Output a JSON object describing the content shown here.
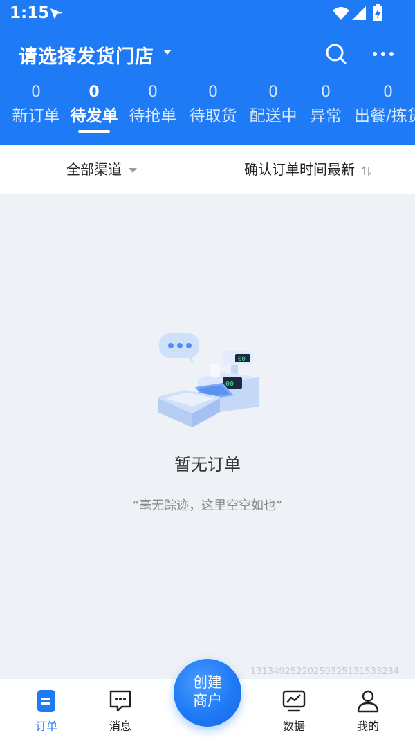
{
  "status_bar": {
    "time": "1:15"
  },
  "header": {
    "store_title": "请选择发货门店",
    "tabs": [
      {
        "count": "0",
        "label": "新订单"
      },
      {
        "count": "0",
        "label": "待发单"
      },
      {
        "count": "0",
        "label": "待抢单"
      },
      {
        "count": "0",
        "label": "待取货"
      },
      {
        "count": "0",
        "label": "配送中"
      },
      {
        "count": "0",
        "label": "异常"
      },
      {
        "count": "0",
        "label": "出餐/拣货"
      }
    ],
    "active_tab": "待发单"
  },
  "filters": {
    "channel": "全部渠道",
    "sort": "确认订单时间最新"
  },
  "empty_state": {
    "title": "暂无订单",
    "subtitle": "“毫无踪迹，这里空空如也”"
  },
  "watermark": "13134925220250325131533234",
  "bottom_nav": {
    "orders": "订单",
    "messages": "消息",
    "create_line1": "创建",
    "create_line2": "商户",
    "data": "数据",
    "mine": "我的"
  },
  "colors": {
    "primary": "#1f7af5",
    "background": "#eef1f6"
  }
}
